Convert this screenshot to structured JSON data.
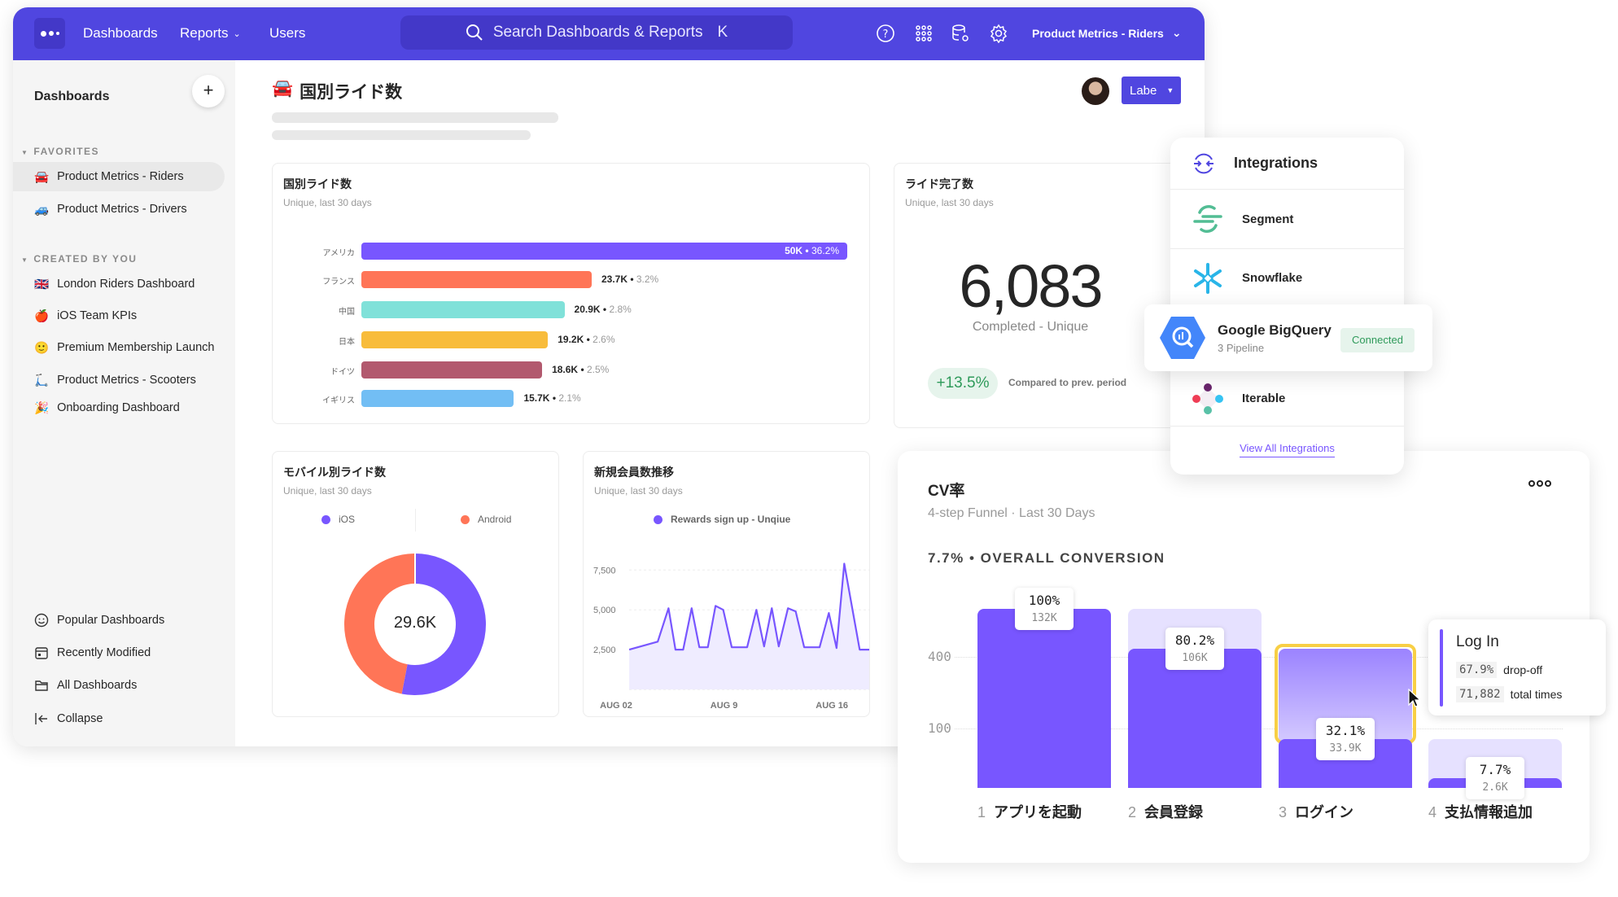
{
  "header": {
    "nav": [
      {
        "label": "Dashboards"
      },
      {
        "label": "Reports"
      },
      {
        "label": "Users"
      }
    ],
    "search_placeholder": "Search Dashboards & Reports",
    "search_shortcut": "K",
    "project": "Product Metrics - Riders",
    "icons": [
      "help-icon",
      "apps-grid-icon",
      "database-settings-icon",
      "gear-icon"
    ]
  },
  "sidebar": {
    "title": "Dashboards",
    "favorites_label": "FAVORITES",
    "favorites": [
      {
        "emoji": "🚘",
        "label": "Product Metrics - Riders"
      },
      {
        "emoji": "🚙",
        "label": "Product Metrics - Drivers"
      }
    ],
    "created_label": "CREATED BY YOU",
    "created": [
      {
        "emoji": "🇬🇧",
        "label": "London Riders Dashboard"
      },
      {
        "emoji": "🍎",
        "label": "iOS Team KPIs"
      },
      {
        "emoji": "🙂",
        "label": "Premium Membership Launch"
      },
      {
        "emoji": "🛴",
        "label": "Product Metrics - Scooters"
      },
      {
        "emoji": "🎉",
        "label": "Onboarding Dashboard"
      }
    ],
    "bottom": [
      {
        "icon": "smiley-icon",
        "label": "Popular Dashboards"
      },
      {
        "icon": "calendar-icon",
        "label": "Recently Modified"
      },
      {
        "icon": "folder-icon",
        "label": "All Dashboards"
      },
      {
        "icon": "collapse-arrow-icon",
        "label": "Collapse"
      }
    ]
  },
  "page": {
    "emoji": "🚘",
    "title": "国別ライド数",
    "label_button": "Labe"
  },
  "kpi": {
    "title": "ライド完了数",
    "subtitle": "Unique, last 30 days",
    "value": "6,083",
    "caption": "Completed - Unique",
    "change": "+13.5%",
    "compare": "Compared to prev. period"
  },
  "integrations": {
    "title": "Integrations",
    "items": [
      {
        "name": "Segment"
      },
      {
        "name": "Snowflake"
      },
      {
        "name": "Google BigQuery",
        "sub": "3 Pipeline",
        "status": "Connected"
      },
      {
        "name": "Iterable"
      }
    ],
    "view_all": "View All Integrations"
  },
  "tooltip": {
    "title": "Log In",
    "dropoff_value": "67.9%",
    "dropoff_label": "drop-off",
    "total_value": "71,882",
    "total_label": "total times"
  },
  "colors": {
    "brand": "#5046e0",
    "purple": "#7856ff",
    "light_purple": "#e6e1ff",
    "highlight": "#f8cf45"
  },
  "chart_data": [
    {
      "type": "bar",
      "title": "国別ライド数",
      "subtitle": "Unique, last 30 days",
      "orientation": "horizontal",
      "categories": [
        "アメリカ",
        "フランス",
        "中国",
        "日本",
        "ドイツ",
        "イギリス"
      ],
      "values": [
        50000,
        23700,
        20900,
        19200,
        18600,
        15700
      ],
      "value_labels": [
        "50K",
        "23.7K",
        "20.9K",
        "19.2K",
        "18.6K",
        "15.7K"
      ],
      "percent_labels": [
        "36.2%",
        "3.2%",
        "2.8%",
        "2.6%",
        "2.5%",
        "2.1%"
      ],
      "colors": [
        "#7856ff",
        "#ff7557",
        "#80e1d9",
        "#f8bc3b",
        "#b2596e",
        "#72bef4"
      ]
    },
    {
      "type": "pie",
      "title": "モバイル別ライド数",
      "subtitle": "Unique, last 30 days",
      "donut": true,
      "center_label": "29.6K",
      "series": [
        {
          "name": "iOS",
          "value": 53,
          "color": "#7856ff"
        },
        {
          "name": "Android",
          "value": 47,
          "color": "#ff7557"
        }
      ]
    },
    {
      "type": "area",
      "title": "新規会員数推移",
      "subtitle": "Unique, last 30 days",
      "series": [
        {
          "name": "Rewards sign up - Unqiue",
          "color": "#7856ff",
          "x": [
            2.85,
            4.7,
            5.4,
            5.85,
            6.35,
            6.9,
            7.4,
            7.95,
            8.45,
            8.95,
            9.5,
            10.5,
            11.1,
            11.6,
            12.1,
            12.55,
            13.15,
            13.65,
            14.2,
            15.2,
            15.8,
            16.3,
            16.8,
            17.8,
            18.6
          ],
          "y": [
            2500,
            3000,
            5100,
            2500,
            2500,
            5100,
            2650,
            2650,
            5250,
            5000,
            2650,
            2650,
            5000,
            2700,
            5100,
            2700,
            5100,
            4900,
            2650,
            2650,
            4800,
            2600,
            7900,
            2500,
            2500
          ]
        }
      ],
      "x_ticks": [
        {
          "value": 2,
          "label": "AUG 02"
        },
        {
          "value": 9,
          "label": "AUG 9"
        },
        {
          "value": 16,
          "label": "AUG 16"
        }
      ],
      "y_ticks": [
        {
          "value": 7500,
          "label": "7,500"
        },
        {
          "value": 5000,
          "label": "5,000"
        },
        {
          "value": 2500,
          "label": "2,500"
        }
      ],
      "ylim": [
        0,
        7500
      ],
      "grid": true,
      "legend": "top"
    },
    {
      "type": "bar",
      "title": "CV率",
      "subtitle": "4-step Funnel · Last 30 Days",
      "headline": "7.7% • OVERALL CONVERSION",
      "y_ticks": [
        "400",
        "100"
      ],
      "steps": [
        {
          "n": "1",
          "label": "アプリを起動",
          "pct": "100%",
          "count": "132K",
          "value": 1.0
        },
        {
          "n": "2",
          "label": "会員登録",
          "pct": "80.2%",
          "count": "106K",
          "value": 0.802
        },
        {
          "n": "3",
          "label": "ログイン",
          "pct": "32.1%",
          "count": "33.9K",
          "value": 0.321,
          "highlighted": true
        },
        {
          "n": "4",
          "label": "支払情報追加",
          "pct": "7.7%",
          "count": "2.6K",
          "value": 0.077
        }
      ]
    }
  ]
}
